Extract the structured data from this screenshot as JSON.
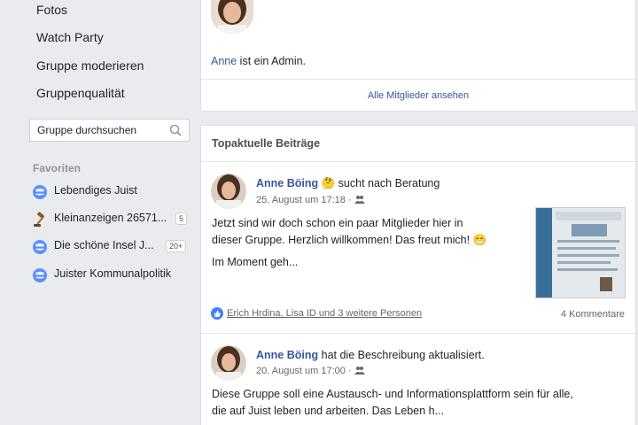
{
  "sidebar": {
    "nav": [
      "Fotos",
      "Watch Party",
      "Gruppe moderieren",
      "Gruppenqualität"
    ],
    "search_placeholder": "Gruppe durchsuchen",
    "favorites_title": "Favoriten",
    "favorites": [
      {
        "label": "Lebendiges Juist",
        "badge": "",
        "icon": "group-icon"
      },
      {
        "label": "Kleinanzeigen 26571...",
        "badge": "5",
        "icon": "gavel-icon"
      },
      {
        "label": "Die schöne Insel J...",
        "badge": "20+",
        "icon": "group-icon"
      },
      {
        "label": "Juister Kommunalpolitik",
        "badge": "",
        "icon": "group-icon"
      }
    ]
  },
  "admin_card": {
    "admin_name": "Anne",
    "admin_suffix": " ist ein Admin.",
    "all_members": "Alle Mitglieder ansehen"
  },
  "top_posts": {
    "title": "Topaktuelle Beiträge",
    "posts": [
      {
        "author": "Anne Böing",
        "emoji": "🤔",
        "action": " sucht nach Beratung",
        "time": "25. August um 17:18",
        "text_line1": "Jetzt sind wir doch schon ein paar Mitglieder hier in",
        "text_line2": "dieser Gruppe. Herzlich willkommen! Das freut mich! 😁",
        "text_line3": "Im Moment geh...",
        "reactions": "Erich Hrdina, Lisa ID und 3 weitere Personen",
        "comments": "4 Kommentare"
      },
      {
        "author": "Anne Böing",
        "action": " hat die Beschreibung aktualisiert.",
        "time": "20. August um 17:00",
        "text_line1": "Diese Gruppe soll eine Austausch- und Informationsplattform sein für alle,",
        "text_line2": "die auf Juist leben und arbeiten. Das Leben h..."
      }
    ]
  },
  "colors": {
    "link": "#365899",
    "background": "#e9ebee",
    "like": "#4080ff"
  }
}
